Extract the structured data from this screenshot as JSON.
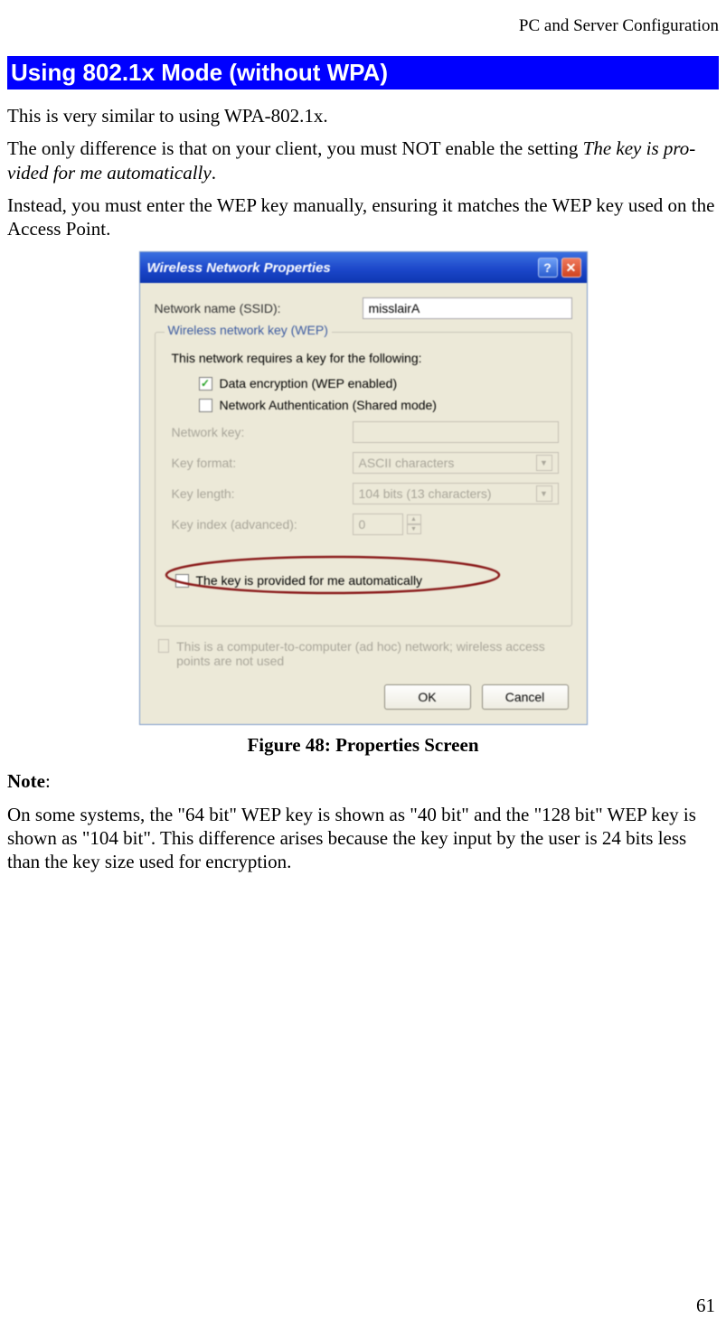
{
  "header": {
    "right_text": "PC and Server Configuration"
  },
  "section": {
    "title": "Using 802.1x Mode (without WPA)"
  },
  "paragraphs": {
    "p1": "This is very similar to using WPA-802.1x.",
    "p2a": "The only difference is that on your client, you must NOT enable the setting ",
    "p2b_italic": "The key is pro-vided for me automatically",
    "p2c": ".",
    "p3": "Instead, you must enter the WEP key manually, ensuring it matches the WEP key used on the Access Point."
  },
  "dialog": {
    "title": "Wireless Network Properties",
    "ssid_label": "Network name (SSID):",
    "ssid_value": "misslairA",
    "group_legend": "Wireless network key (WEP)",
    "group_desc": "This network requires a key for the following:",
    "chk_data_encryption": "Data encryption (WEP enabled)",
    "chk_net_auth": "Network Authentication (Shared mode)",
    "lbl_network_key": "Network key:",
    "lbl_key_format": "Key format:",
    "val_key_format": "ASCII characters",
    "lbl_key_length": "Key length:",
    "val_key_length": "104 bits (13 characters)",
    "lbl_key_index": "Key index (advanced):",
    "val_key_index": "0",
    "chk_key_auto": "The key is provided for me automatically",
    "adhoc_text": "This is a computer-to-computer (ad hoc) network; wireless access points are not used",
    "btn_ok": "OK",
    "btn_cancel": "Cancel"
  },
  "figure_caption": "Figure 48: Properties Screen",
  "note": {
    "label": "Note",
    "colon": ":",
    "text": "On some systems, the \"64 bit\" WEP key is shown as \"40 bit\" and the \"128 bit\" WEP key is shown as \"104 bit\". This difference arises because the key input by the user is 24 bits less than the key size used for encryption."
  },
  "page_number": "61"
}
